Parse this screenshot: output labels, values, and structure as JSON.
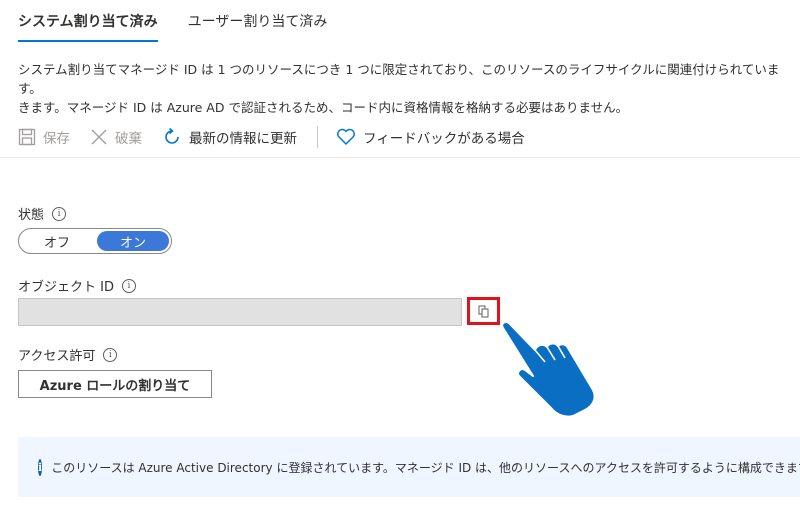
{
  "tabs": [
    {
      "label": "システム割り当て済み",
      "active": true
    },
    {
      "label": "ユーザー割り当て済み",
      "active": false
    }
  ],
  "description": {
    "line1": "システム割り当てマネージド ID は 1 つのリソースにつき 1 つに限定されており、このリソースのライフサイクルに関連付けられています。",
    "line2": "きます。マネージド ID は Azure AD で認証されるため、コード内に資格情報を格納する必要はありません。"
  },
  "toolbar": {
    "save": "保存",
    "discard": "破棄",
    "refresh": "最新の情報に更新",
    "feedback": "フィードバックがある場合"
  },
  "status": {
    "label": "状態",
    "off": "オフ",
    "on": "オン",
    "selected": "on"
  },
  "object_id": {
    "label": "オブジェクト ID",
    "value": ""
  },
  "access": {
    "label": "アクセス許可",
    "button": "Azure ロールの割り当て"
  },
  "info_banner": {
    "text": "このリソースは Azure Active Directory に登録されています。マネージド ID は、他のリソースへのアクセスを許可するように構成できます。"
  },
  "colors": {
    "accent": "#0078d4",
    "toggle_on": "#3c78d8",
    "highlight": "#e0131d",
    "hand": "#0a6fc2"
  }
}
